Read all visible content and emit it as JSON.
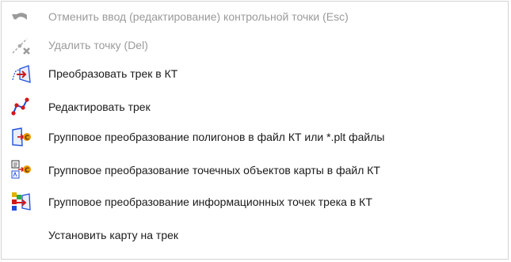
{
  "menu": {
    "items": [
      {
        "label": "Отменить ввод (редактирование) контрольной точки (Esc)",
        "icon": "undo-icon",
        "enabled": false
      },
      {
        "label": "Удалить точку (Del)",
        "icon": "delete-point-icon",
        "enabled": false
      },
      {
        "label": "Преобразовать трек в КТ",
        "icon": "convert-track-to-kt-icon",
        "enabled": true
      },
      {
        "label": "Редактировать трек",
        "icon": "edit-track-icon",
        "enabled": true
      },
      {
        "label": "Групповое преобразование полигонов  в файл КТ или *.plt файлы",
        "icon": "batch-convert-polygons-icon",
        "enabled": true
      },
      {
        "label": "Групповое преобразование точечных объектов карты в файл КТ",
        "icon": "batch-convert-point-objects-icon",
        "enabled": true
      },
      {
        "label": "Групповое преобразование информационных точек трека в КТ",
        "icon": "batch-convert-info-points-icon",
        "enabled": true
      },
      {
        "label": "Установить карту на трек",
        "icon": "",
        "enabled": true
      }
    ]
  },
  "colors": {
    "disabled_text": "#9a9a9a",
    "text": "#1a1a1a",
    "border": "#d3d3d3",
    "accent_blue": "#1f4fd8",
    "accent_red": "#d01818",
    "accent_orange": "#e69a00"
  }
}
